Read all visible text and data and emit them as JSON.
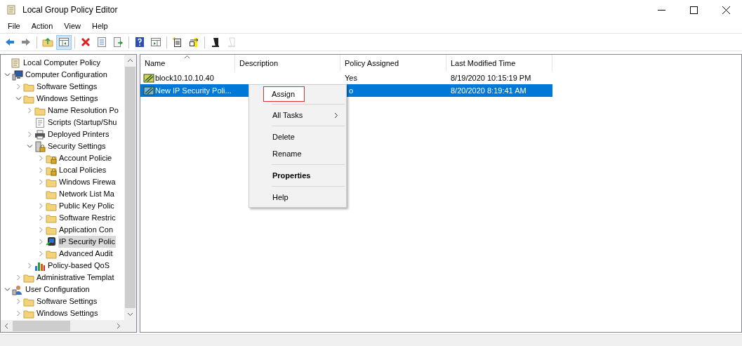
{
  "window": {
    "title": "Local Group Policy Editor"
  },
  "menu_bar": [
    "File",
    "Action",
    "View",
    "Help"
  ],
  "toolbar": [
    {
      "kind": "back",
      "pressed": false,
      "disabled": false
    },
    {
      "kind": "forward",
      "pressed": false,
      "disabled": false
    },
    {
      "kind": "separator"
    },
    {
      "kind": "up",
      "pressed": false,
      "disabled": false
    },
    {
      "kind": "tree",
      "pressed": true,
      "disabled": false
    },
    {
      "kind": "separator"
    },
    {
      "kind": "delete",
      "pressed": false,
      "disabled": false
    },
    {
      "kind": "properties",
      "pressed": false,
      "disabled": false
    },
    {
      "kind": "export",
      "pressed": false,
      "disabled": false
    },
    {
      "kind": "separator"
    },
    {
      "kind": "help",
      "pressed": false,
      "disabled": false
    },
    {
      "kind": "pane",
      "pressed": false,
      "disabled": false
    },
    {
      "kind": "separator"
    },
    {
      "kind": "new",
      "pressed": false,
      "disabled": false
    },
    {
      "kind": "assign",
      "pressed": false,
      "disabled": false
    },
    {
      "kind": "separator"
    },
    {
      "kind": "manage",
      "pressed": false,
      "disabled": false
    },
    {
      "kind": "unassign",
      "pressed": false,
      "disabled": true
    }
  ],
  "tree": [
    {
      "label": "Local Computer Policy",
      "kind": "policy",
      "selected": false,
      "children": [
        {
          "label": "Computer Configuration",
          "kind": "computer",
          "expanded": true,
          "selected": false,
          "children": [
            {
              "label": "Software Settings",
              "kind": "folder",
              "expanded": false,
              "selected": false
            },
            {
              "label": "Windows Settings",
              "kind": "folder",
              "expanded": true,
              "selected": false,
              "children": [
                {
                  "label": "Name Resolution Po",
                  "kind": "folder",
                  "expanded": false,
                  "selected": false
                },
                {
                  "label": "Scripts (Startup/Shu",
                  "kind": "scripts",
                  "selected": false
                },
                {
                  "label": "Deployed Printers",
                  "kind": "printer",
                  "expanded": false,
                  "selected": false
                },
                {
                  "label": "Security Settings",
                  "kind": "security",
                  "expanded": true,
                  "selected": false,
                  "children": [
                    {
                      "label": "Account Policie",
                      "kind": "lockfolder",
                      "expanded": false,
                      "selected": false
                    },
                    {
                      "label": "Local Policies",
                      "kind": "lockfolder",
                      "expanded": false,
                      "selected": false
                    },
                    {
                      "label": "Windows Firewa",
                      "kind": "folder",
                      "expanded": false,
                      "selected": false
                    },
                    {
                      "label": "Network List Ma",
                      "kind": "folder",
                      "selected": false
                    },
                    {
                      "label": "Public Key Polic",
                      "kind": "folder",
                      "expanded": false,
                      "selected": false
                    },
                    {
                      "label": "Software Restric",
                      "kind": "folder",
                      "expanded": false,
                      "selected": false
                    },
                    {
                      "label": "Application Con",
                      "kind": "folder",
                      "expanded": false,
                      "selected": false
                    },
                    {
                      "label": "IP Security Polic",
                      "kind": "ipsec",
                      "expanded": false,
                      "selected": true
                    },
                    {
                      "label": "Advanced Audit",
                      "kind": "folder",
                      "expanded": false,
                      "selected": false
                    }
                  ]
                },
                {
                  "label": "Policy-based QoS",
                  "kind": "qos",
                  "expanded": false,
                  "selected": false
                }
              ]
            },
            {
              "label": "Administrative Templat",
              "kind": "folder",
              "expanded": false,
              "selected": false
            }
          ]
        },
        {
          "label": "User Configuration",
          "kind": "user",
          "expanded": true,
          "selected": false,
          "children": [
            {
              "label": "Software Settings",
              "kind": "folder",
              "expanded": false,
              "selected": false
            },
            {
              "label": "Windows Settings",
              "kind": "folder",
              "expanded": false,
              "selected": false
            }
          ]
        }
      ]
    }
  ],
  "table": {
    "columns": [
      "Name",
      "Description",
      "Policy Assigned",
      "Last Modified Time"
    ],
    "rows": [
      {
        "name": "block10.10.10.40",
        "assigned": "Yes",
        "modified": "8/19/2020 10:15:19 PM",
        "selected": false
      },
      {
        "name": "New IP Security Poli...",
        "assigned": "o",
        "modified": "8/20/2020 8:19:41 AM",
        "selected": true
      }
    ]
  },
  "context_menu": [
    {
      "kind": "item",
      "label": "Assign",
      "highlighted": true,
      "default": false,
      "submenu": false
    },
    {
      "kind": "separator"
    },
    {
      "kind": "item",
      "label": "All Tasks",
      "highlighted": false,
      "default": false,
      "submenu": true
    },
    {
      "kind": "separator"
    },
    {
      "kind": "item",
      "label": "Delete",
      "highlighted": false,
      "default": false,
      "submenu": false
    },
    {
      "kind": "item",
      "label": "Rename",
      "highlighted": false,
      "default": false,
      "submenu": false
    },
    {
      "kind": "separator"
    },
    {
      "kind": "item",
      "label": "Properties",
      "highlighted": false,
      "default": true,
      "submenu": false
    },
    {
      "kind": "separator"
    },
    {
      "kind": "item",
      "label": "Help",
      "highlighted": false,
      "default": false,
      "submenu": false
    }
  ]
}
